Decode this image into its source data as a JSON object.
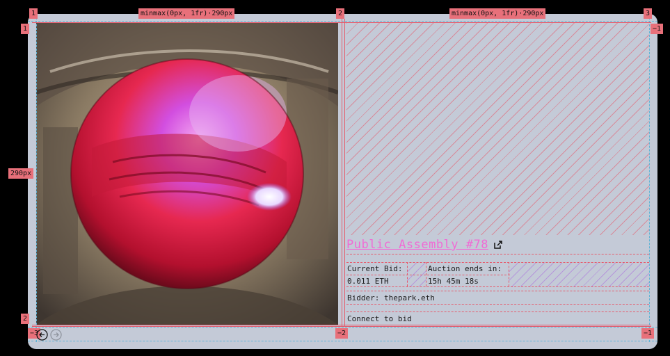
{
  "grid_labels": {
    "col_top": [
      "1",
      "2",
      "3"
    ],
    "col_size_left": "minmax(0px, 1fr)·290px",
    "col_size_right": "minmax(0px, 1fr)·290px",
    "row_left": [
      "1",
      "2"
    ],
    "row_right_top": "−1",
    "row_size": "290px",
    "col_bottom": [
      "−3",
      "−2",
      "−1"
    ],
    "row_right_bottom": "−1"
  },
  "nft": {
    "title": "Public Assembly #78",
    "current_bid_label": "Current Bid:",
    "current_bid_value": "0.011 ETH",
    "auction_ends_label": "Auction ends in:",
    "auction_ends_value": "15h 45m 18s",
    "bidder": "Bidder: thepark.eth",
    "connect": "Connect to bid"
  },
  "icons": {
    "external": "external-link-icon",
    "prev": "arrow-left-icon",
    "next": "arrow-right-icon"
  },
  "colors": {
    "accent": "#f06bd5",
    "grid_overlay": "#e65a6b",
    "card_bg": "#c4cad7"
  }
}
